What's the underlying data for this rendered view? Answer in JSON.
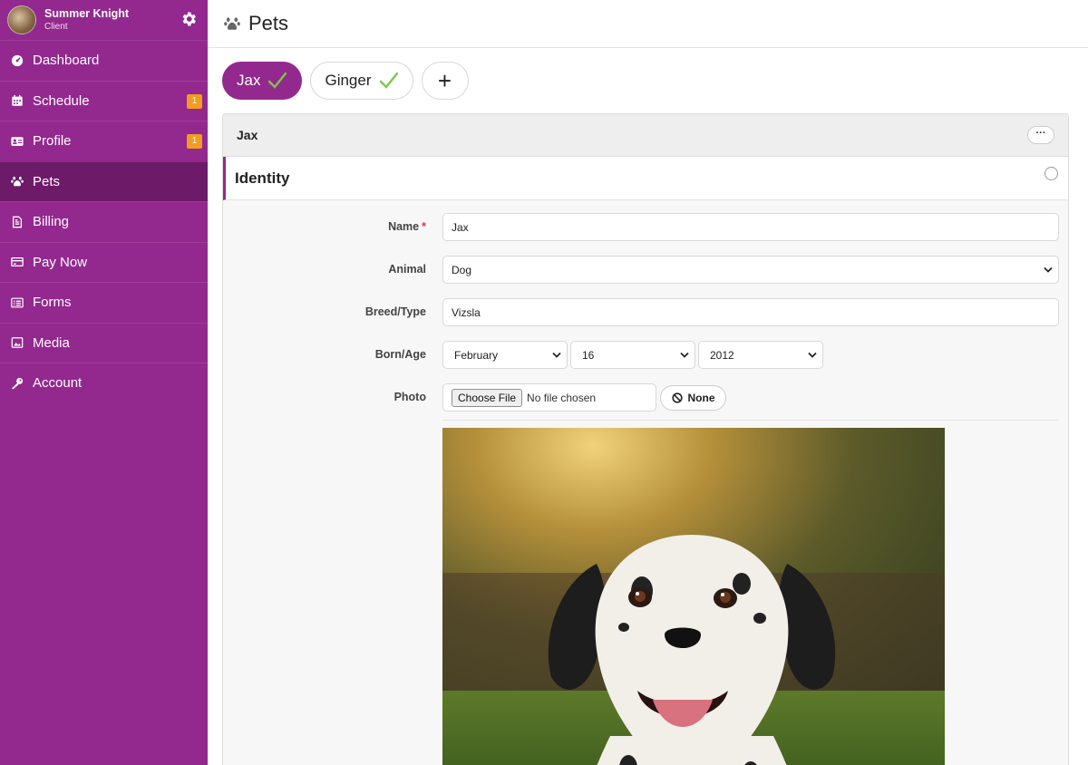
{
  "user": {
    "name": "Summer Knight",
    "role": "Client"
  },
  "nav": [
    {
      "label": "Dashboard",
      "icon": "dashboard-icon",
      "badge": ""
    },
    {
      "label": "Schedule",
      "icon": "calendar-icon",
      "badge": "1"
    },
    {
      "label": "Profile",
      "icon": "id-card-icon",
      "badge": "1"
    },
    {
      "label": "Pets",
      "icon": "paw-icon",
      "badge": ""
    },
    {
      "label": "Billing",
      "icon": "file-icon",
      "badge": ""
    },
    {
      "label": "Pay Now",
      "icon": "credit-card-icon",
      "badge": ""
    },
    {
      "label": "Forms",
      "icon": "list-icon",
      "badge": ""
    },
    {
      "label": "Media",
      "icon": "image-icon",
      "badge": ""
    },
    {
      "label": "Account",
      "icon": "key-icon",
      "badge": ""
    }
  ],
  "page": {
    "title": "Pets"
  },
  "pets": [
    {
      "name": "Jax"
    },
    {
      "name": "Ginger"
    }
  ],
  "add_label": "+",
  "card": {
    "title": "Jax",
    "more_label": "···"
  },
  "section": {
    "title": "Identity"
  },
  "form": {
    "name_label": "Name",
    "name_required": "*",
    "name_value": "Jax",
    "animal_label": "Animal",
    "animal_value": "Dog",
    "breed_label": "Breed/Type",
    "breed_value": "Vizsla",
    "born_label": "Born/Age",
    "born_month": "February",
    "born_day": "16",
    "born_year": "2012",
    "photo_label": "Photo",
    "choose_file_label": "Choose File",
    "no_file_text": "No file chosen",
    "none_label": "None"
  },
  "colors": {
    "accent": "#93288f",
    "accent_dark": "#6d1a69",
    "badge": "#f39c1f",
    "check": "#7ac943"
  }
}
